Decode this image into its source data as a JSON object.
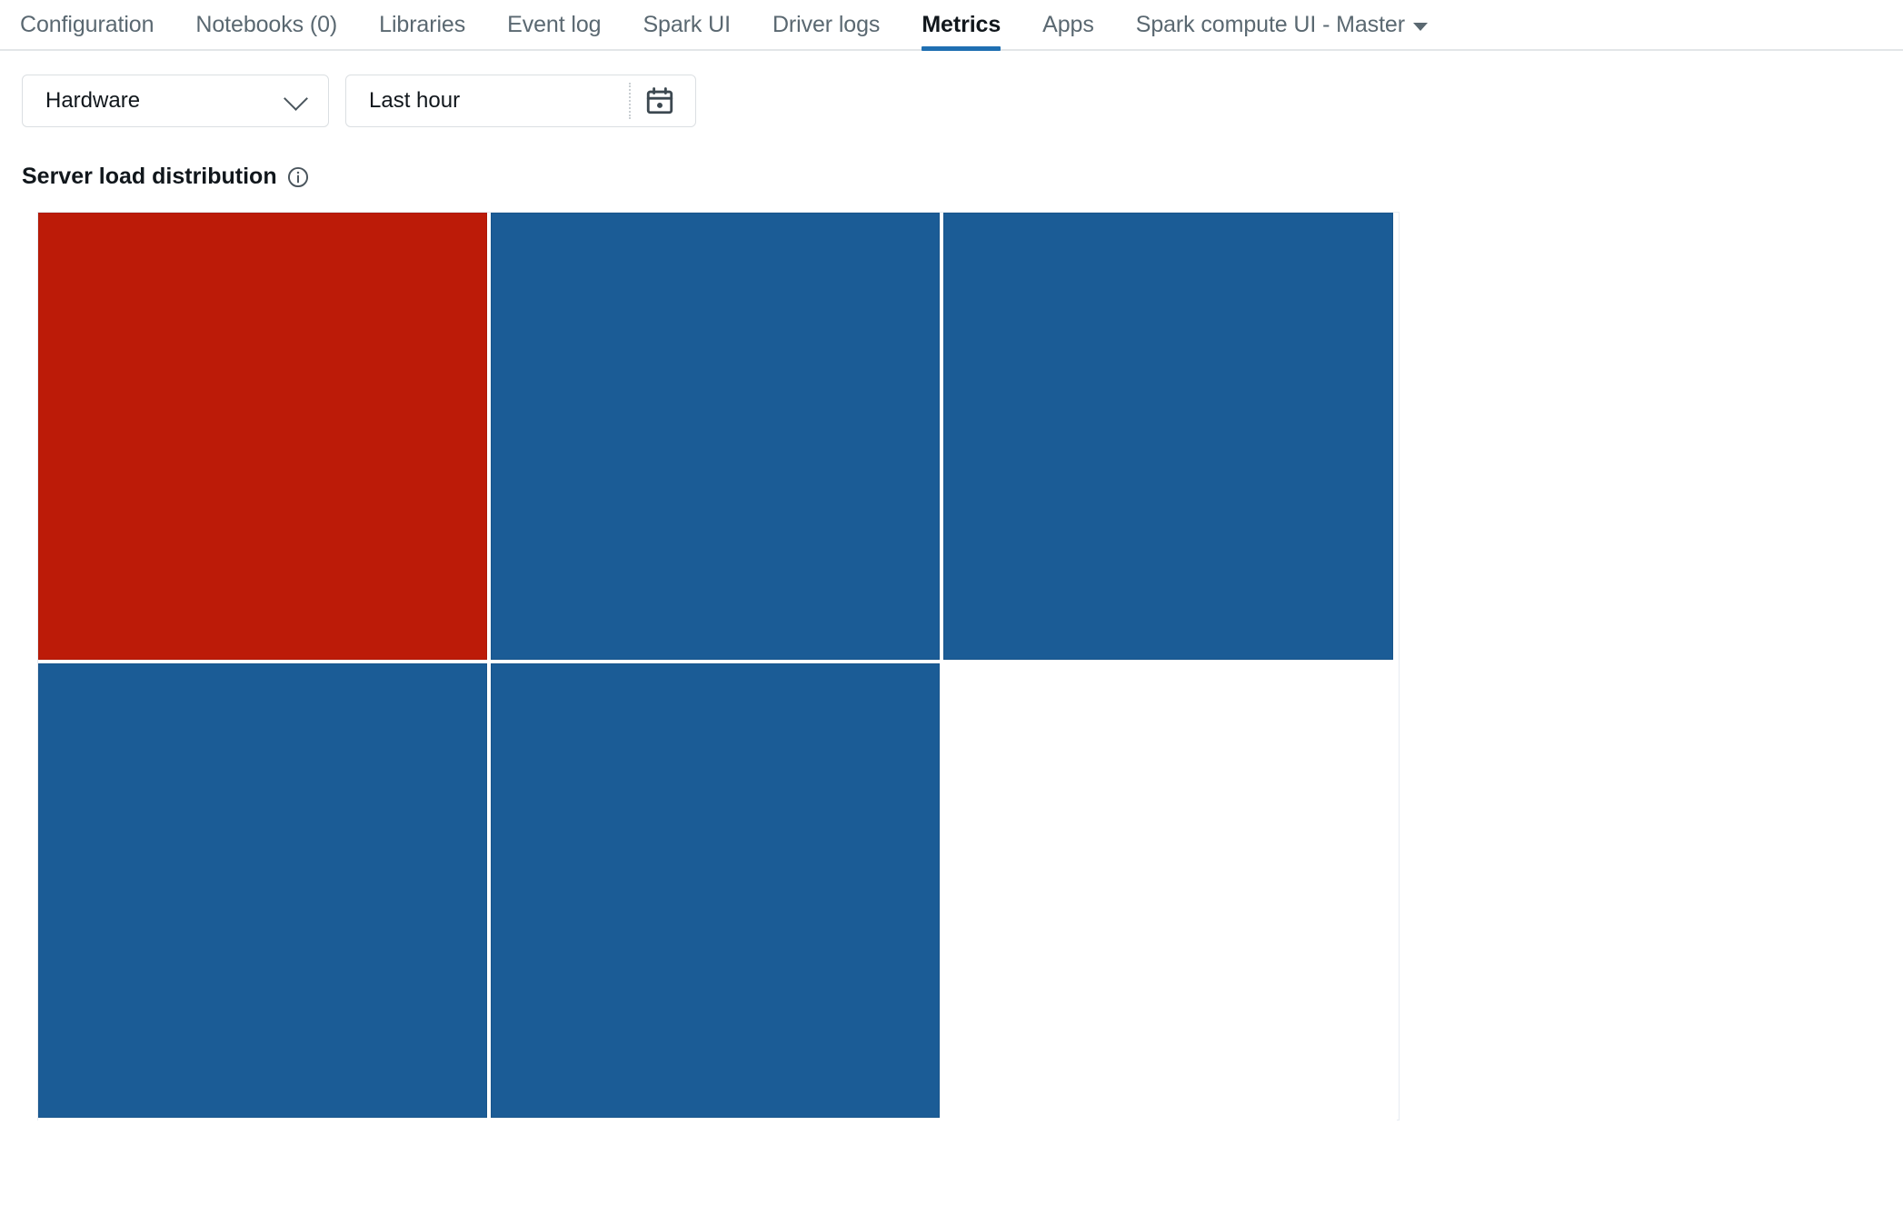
{
  "tabs": [
    {
      "label": "Configuration",
      "active": false
    },
    {
      "label": "Notebooks (0)",
      "active": false
    },
    {
      "label": "Libraries",
      "active": false
    },
    {
      "label": "Event log",
      "active": false
    },
    {
      "label": "Spark UI",
      "active": false
    },
    {
      "label": "Driver logs",
      "active": false
    },
    {
      "label": "Metrics",
      "active": true
    },
    {
      "label": "Apps",
      "active": false
    }
  ],
  "tab_dropdown": {
    "label": "Spark compute UI - Master",
    "icon": "caret-down-icon"
  },
  "filters": {
    "metric_group": {
      "value": "Hardware",
      "icon": "chevron-down-icon"
    },
    "time_range": {
      "value": "Last hour",
      "icon": "calendar-icon"
    }
  },
  "section": {
    "title": "Server load distribution",
    "info_icon": "info-icon"
  },
  "chart_data": {
    "type": "heatmap",
    "title": "Server load distribution",
    "xlabel": "",
    "ylabel": "",
    "grid": true,
    "legend": "none",
    "colors": {
      "high": "#BC1B08",
      "normal": "#1B5C96",
      "empty": "#FFFFFF",
      "gridline": "#FFFFFF",
      "border": "#E7ECF2"
    },
    "rows": 2,
    "columns": 3,
    "cells": [
      {
        "row": 0,
        "col": 0,
        "state": "high",
        "color": "#BC1B08"
      },
      {
        "row": 0,
        "col": 1,
        "state": "normal",
        "color": "#1B5C96"
      },
      {
        "row": 0,
        "col": 2,
        "state": "normal",
        "color": "#1B5C96"
      },
      {
        "row": 1,
        "col": 0,
        "state": "normal",
        "color": "#1B5C96"
      },
      {
        "row": 1,
        "col": 1,
        "state": "normal",
        "color": "#1B5C96"
      },
      {
        "row": 1,
        "col": 2,
        "state": "empty",
        "color": "#FFFFFF"
      }
    ]
  }
}
